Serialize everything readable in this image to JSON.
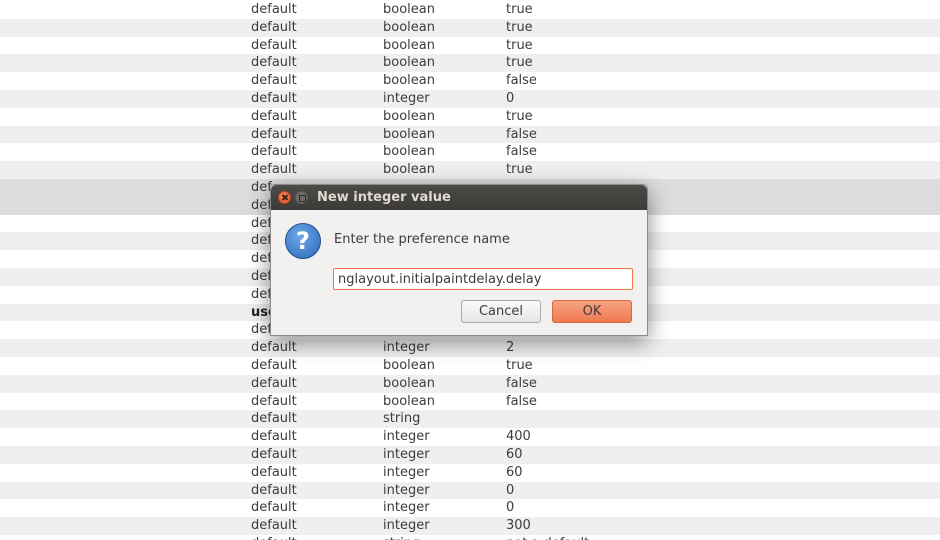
{
  "table": {
    "rows": [
      {
        "status": "default",
        "type": "boolean",
        "value": "true"
      },
      {
        "status": "default",
        "type": "boolean",
        "value": "true"
      },
      {
        "status": "default",
        "type": "boolean",
        "value": "true"
      },
      {
        "status": "default",
        "type": "boolean",
        "value": "true"
      },
      {
        "status": "default",
        "type": "boolean",
        "value": "false"
      },
      {
        "status": "default",
        "type": "integer",
        "value": "0"
      },
      {
        "status": "default",
        "type": "boolean",
        "value": "true"
      },
      {
        "status": "default",
        "type": "boolean",
        "value": "false"
      },
      {
        "status": "default",
        "type": "boolean",
        "value": "false"
      },
      {
        "status": "default",
        "type": "boolean",
        "value": "true"
      },
      {
        "status": "def",
        "type": "",
        "value": ""
      },
      {
        "status": "def",
        "type": "",
        "value": ""
      },
      {
        "status": "def",
        "type": "",
        "value": ""
      },
      {
        "status": "def",
        "type": "",
        "value": ""
      },
      {
        "status": "def",
        "type": "",
        "value": ""
      },
      {
        "status": "def",
        "type": "",
        "value": ""
      },
      {
        "status": "def",
        "type": "",
        "value": ""
      },
      {
        "status": "use",
        "type": "",
        "value": ""
      },
      {
        "status": "def",
        "type": "",
        "value": ""
      },
      {
        "status": "default",
        "type": "integer",
        "value": "2"
      },
      {
        "status": "default",
        "type": "boolean",
        "value": "true"
      },
      {
        "status": "default",
        "type": "boolean",
        "value": "false"
      },
      {
        "status": "default",
        "type": "boolean",
        "value": "false"
      },
      {
        "status": "default",
        "type": "string",
        "value": ""
      },
      {
        "status": "default",
        "type": "integer",
        "value": "400"
      },
      {
        "status": "default",
        "type": "integer",
        "value": "60"
      },
      {
        "status": "default",
        "type": "integer",
        "value": "60"
      },
      {
        "status": "default",
        "type": "integer",
        "value": "0"
      },
      {
        "status": "default",
        "type": "integer",
        "value": "0"
      },
      {
        "status": "default",
        "type": "integer",
        "value": "300"
      },
      {
        "status": "default",
        "type": "string",
        "value": "not a default"
      }
    ]
  },
  "dialog": {
    "title": "New integer value",
    "prompt": "Enter the preference name",
    "input_value": "nglayout.initialpaintdelay.delay",
    "cancel_label": "Cancel",
    "ok_label": "OK",
    "icon": "question-icon"
  },
  "colors": {
    "accent": "#f07746",
    "titlebar": "#3c3b37",
    "row_alt": "#efefef"
  }
}
